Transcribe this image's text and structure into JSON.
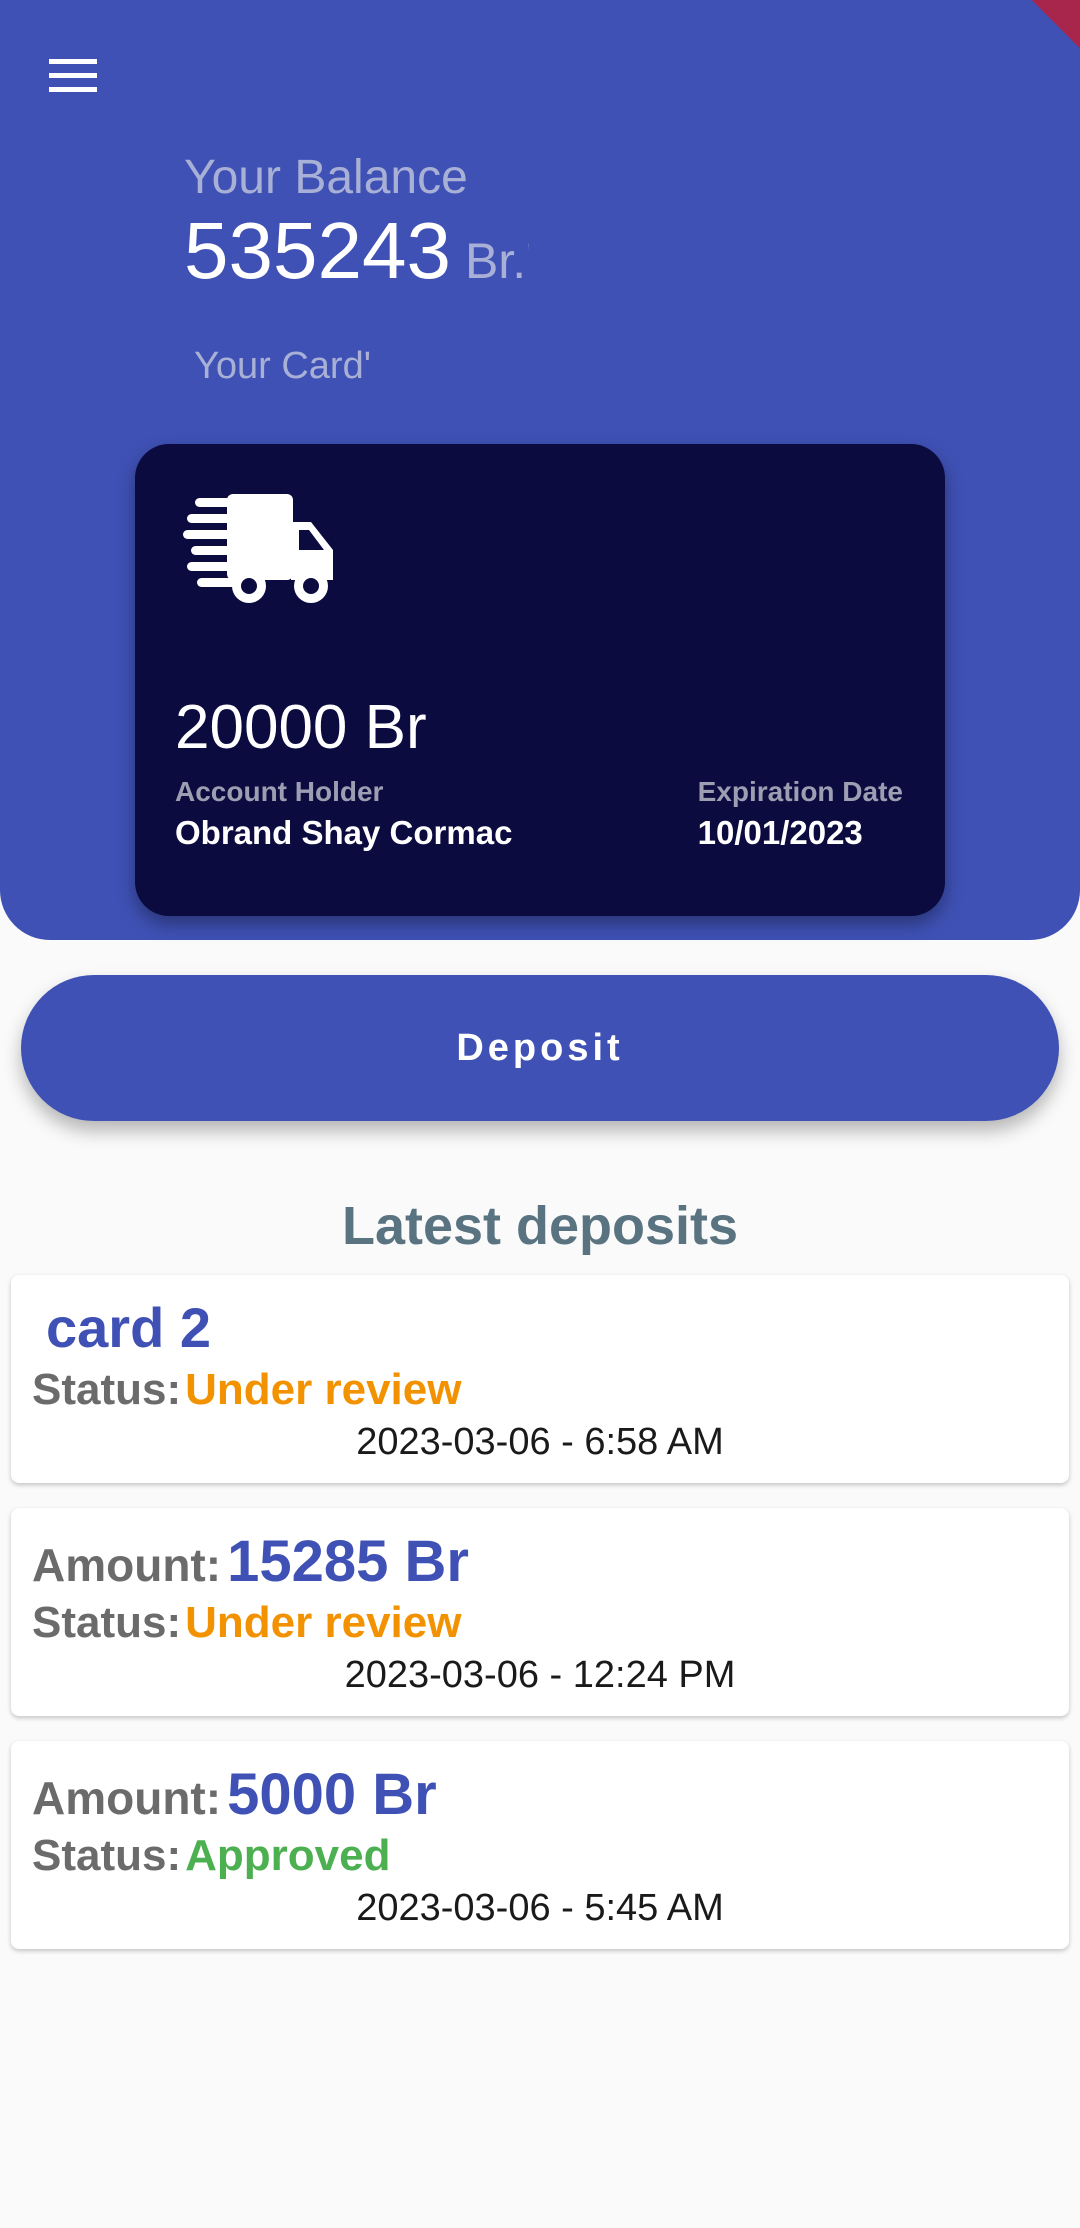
{
  "header": {
    "balance_label": "Your Balance",
    "balance_value": "535243",
    "balance_unit": "Br.'",
    "card_label": "Your Card'"
  },
  "card": {
    "icon": "shipping-truck-icon",
    "amount": "20000 Br",
    "holder_label": "Account Holder",
    "holder_name": "Obrand Shay Cormac",
    "expiration_label": "Expiration Date",
    "expiration_date": "10/01/2023"
  },
  "deposit_button": {
    "label": "Deposit"
  },
  "deposits": {
    "title": "Latest deposits",
    "items": [
      {
        "card_name": "card 2",
        "status_label": "Status:",
        "status": "Under review",
        "date": "2023-03-06 - 6:58 AM"
      },
      {
        "amount_label": "Amount:",
        "amount": "15285 Br",
        "status_label": "Status:",
        "status": "Under review",
        "date": "2023-03-06 - 12:24 PM"
      },
      {
        "amount_label": "Amount:",
        "amount": "5000 Br",
        "status_label": "Status:",
        "status": "Approved",
        "date": "2023-03-06 - 5:45 AM"
      }
    ]
  },
  "colors": {
    "primary": "#3f51b5",
    "card_background": "#0b0b40",
    "status_under_review": "#f39200",
    "status_approved": "#4caf50",
    "title_gray": "#5a7380"
  }
}
